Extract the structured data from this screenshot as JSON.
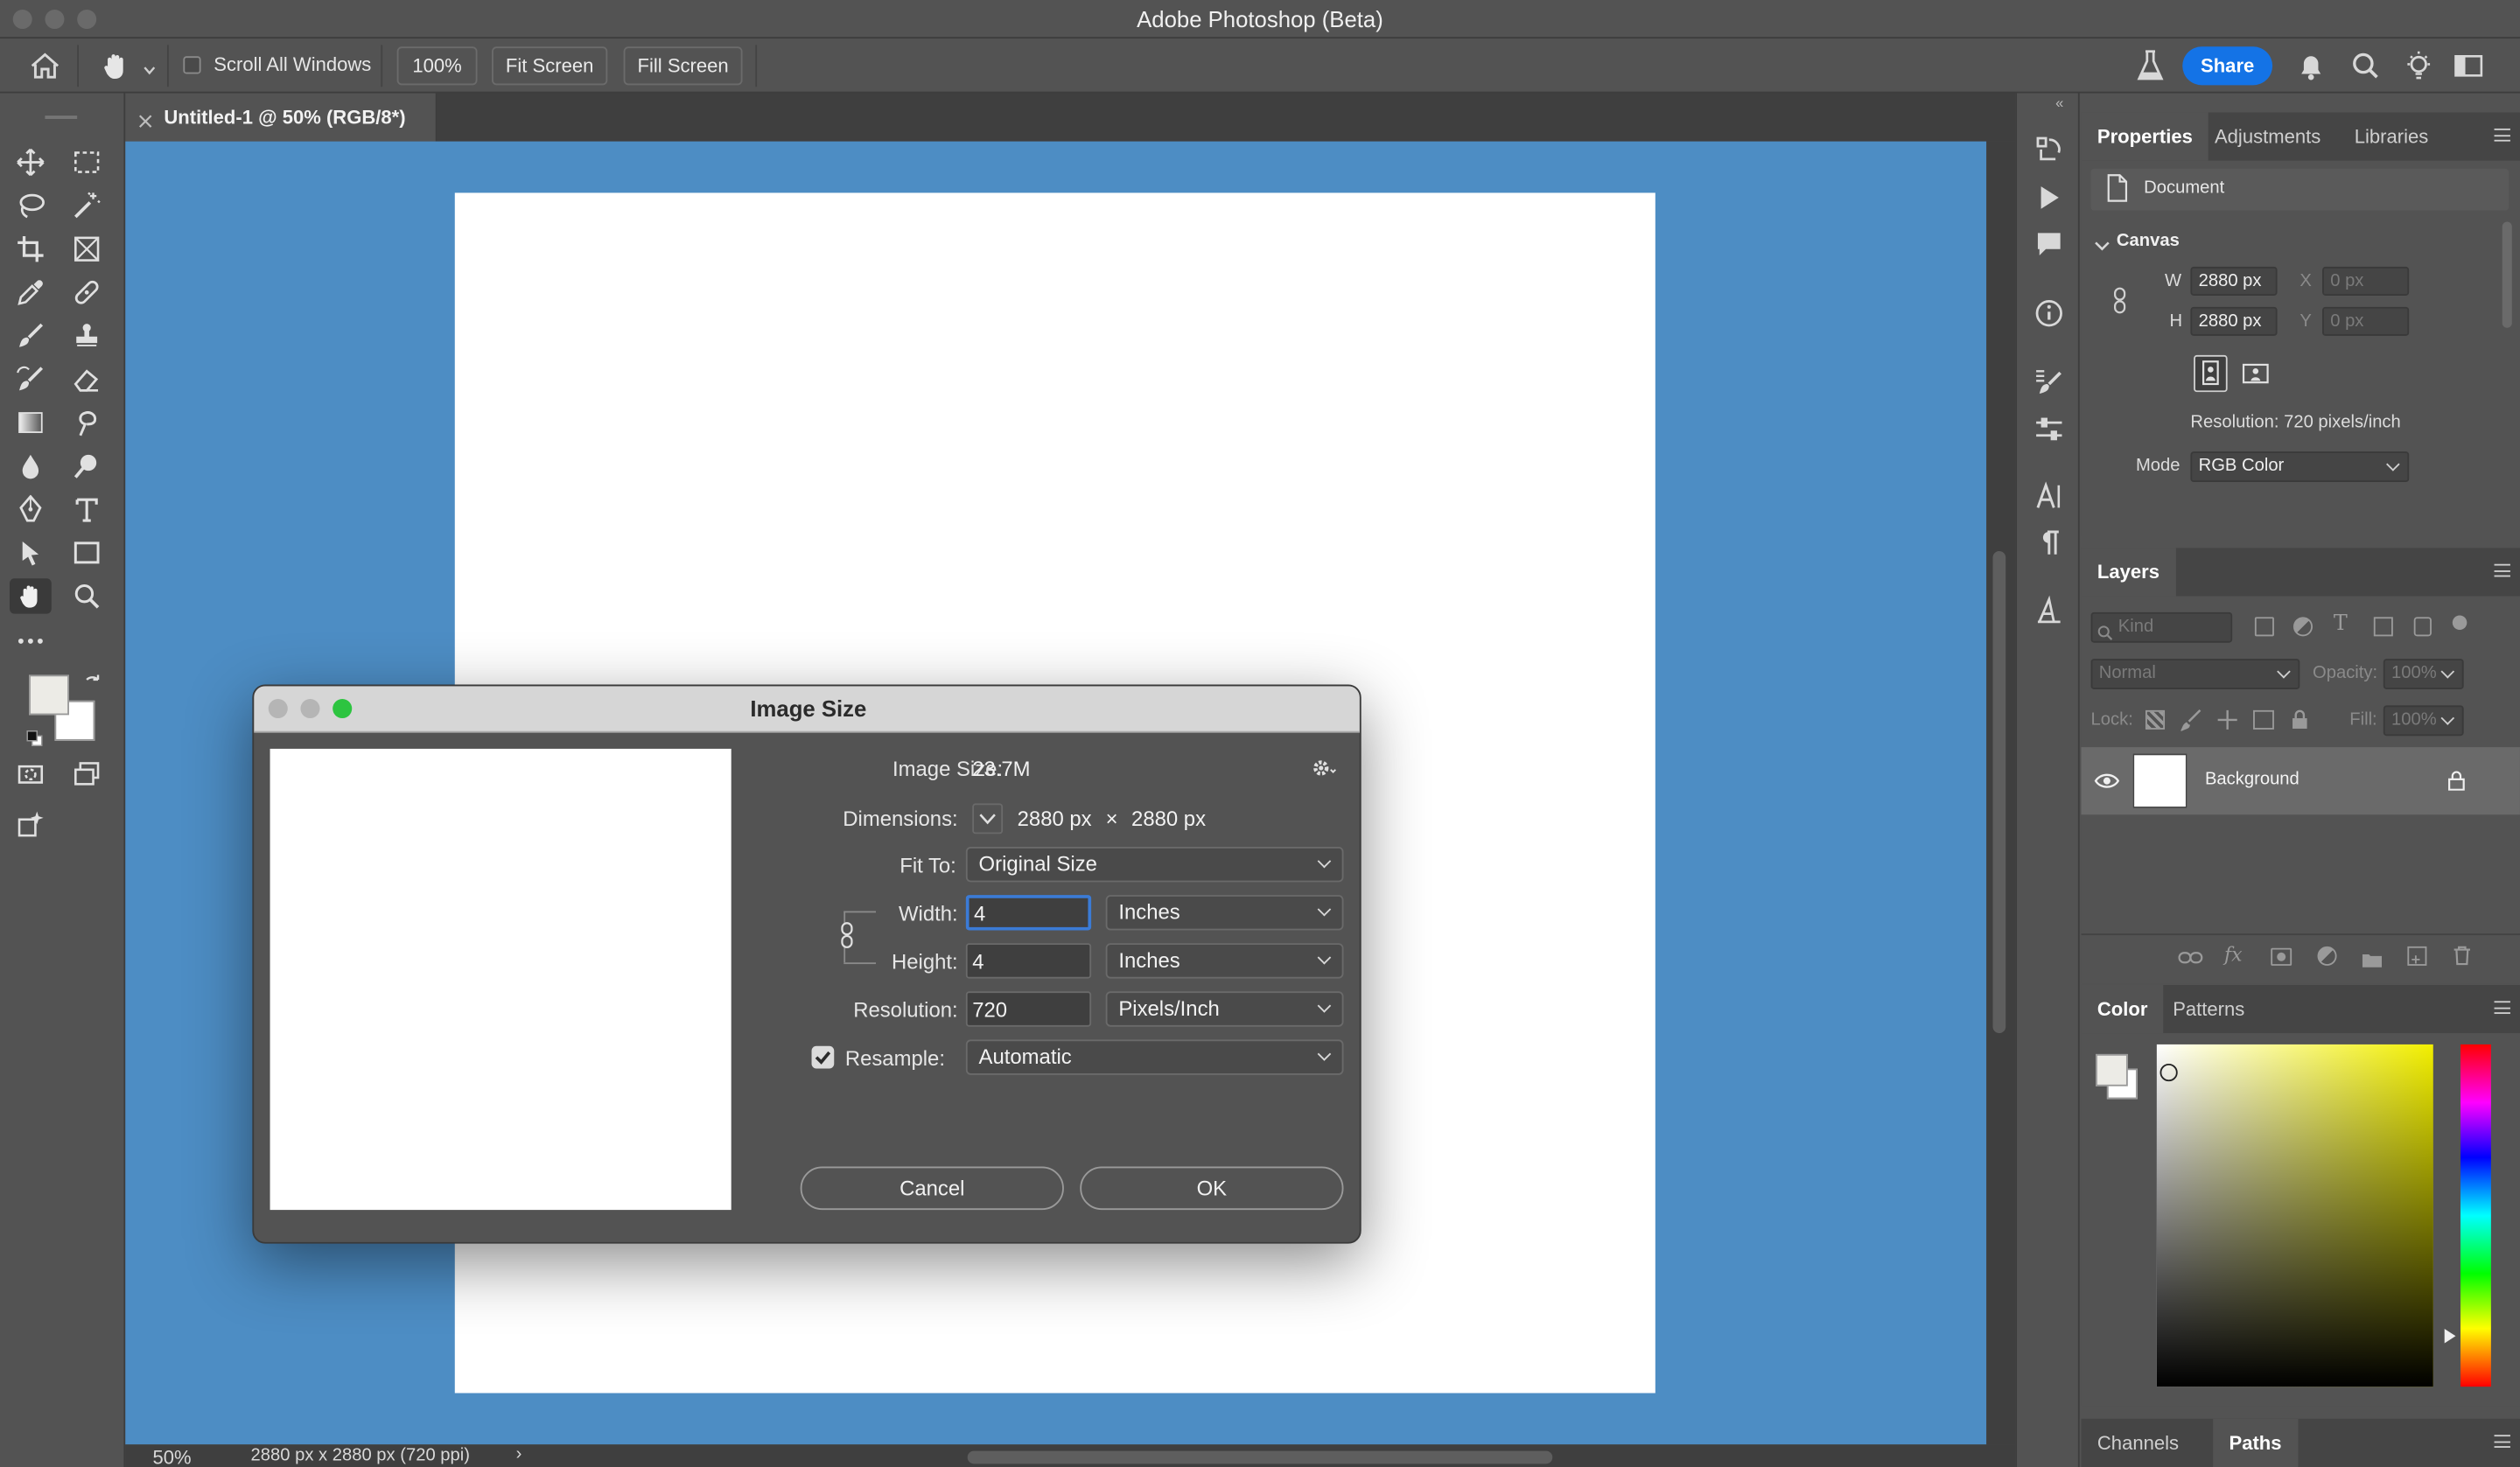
{
  "window": {
    "title": "Adobe Photoshop (Beta)"
  },
  "optionsbar": {
    "scroll_all_label": "Scroll All Windows",
    "zoom_btn": "100%",
    "fit_screen_btn": "Fit Screen",
    "fill_screen_btn": "Fill Screen",
    "share_btn": "Share"
  },
  "document": {
    "tab_title": "Untitled-1 @ 50% (RGB/8*)",
    "status_zoom": "50%",
    "status_info": "2880 px x 2880 px (720 ppi)"
  },
  "properties": {
    "tabs": [
      "Properties",
      "Adjustments",
      "Libraries"
    ],
    "doc_label": "Document",
    "canvas_header": "Canvas",
    "w_label": "W",
    "w_value": "2880 px",
    "h_label": "H",
    "h_value": "2880 px",
    "x_label": "X",
    "x_placeholder": "0 px",
    "y_label": "Y",
    "y_placeholder": "0 px",
    "resolution_text": "Resolution: 720 pixels/inch",
    "mode_label": "Mode",
    "mode_value": "RGB Color"
  },
  "layers": {
    "tab": "Layers",
    "kind_placeholder": "Kind",
    "blend_mode": "Normal",
    "opacity_label": "Opacity:",
    "opacity_value": "100%",
    "lock_label": "Lock:",
    "fill_label": "Fill:",
    "fill_value": "100%",
    "layer_name": "Background"
  },
  "color_panel": {
    "tabs": [
      "Color",
      "Patterns"
    ]
  },
  "bottom_panel": {
    "tabs": [
      "Channels",
      "Paths"
    ]
  },
  "dialog": {
    "title": "Image Size",
    "image_size_label": "Image Size:",
    "image_size_value": "23.7M",
    "dimensions_label": "Dimensions:",
    "dim_w": "2880 px",
    "dim_x": "×",
    "dim_h": "2880 px",
    "fit_to_label": "Fit To:",
    "fit_to_value": "Original Size",
    "width_label": "Width:",
    "width_value": "4",
    "width_unit": "Inches",
    "height_label": "Height:",
    "height_value": "4",
    "height_unit": "Inches",
    "resolution_label": "Resolution:",
    "resolution_value": "720",
    "resolution_unit": "Pixels/Inch",
    "resample_label": "Resample:",
    "resample_value": "Automatic",
    "resample_checked": true,
    "cancel_btn": "Cancel",
    "ok_btn": "OK"
  },
  "colors": {
    "canvas_bg": "#4d8dc4",
    "accent_blue": "#1473e6",
    "traffic_red": "#ec5f59",
    "traffic_yellow": "#e6b93b",
    "traffic_green": "#2dc440"
  },
  "icons": [
    "home-icon",
    "hand-icon",
    "move-icon",
    "marquee-icon",
    "lasso-icon",
    "magic-wand-icon",
    "crop-icon",
    "frame-icon",
    "eyedropper-icon",
    "healing-icon",
    "brush-icon",
    "stamp-icon",
    "history-brush-icon",
    "eraser-icon",
    "gradient-icon",
    "smudge-icon",
    "blur-icon",
    "dodge-icon",
    "pen-icon",
    "type-icon",
    "path-select-icon",
    "rectangle-icon",
    "zoom-icon",
    "more-icon",
    "flask-icon",
    "bell-icon",
    "search-icon",
    "lightbulb-icon",
    "workspace-icon",
    "eye-icon",
    "lock-icon",
    "gear-icon",
    "link-icon"
  ]
}
